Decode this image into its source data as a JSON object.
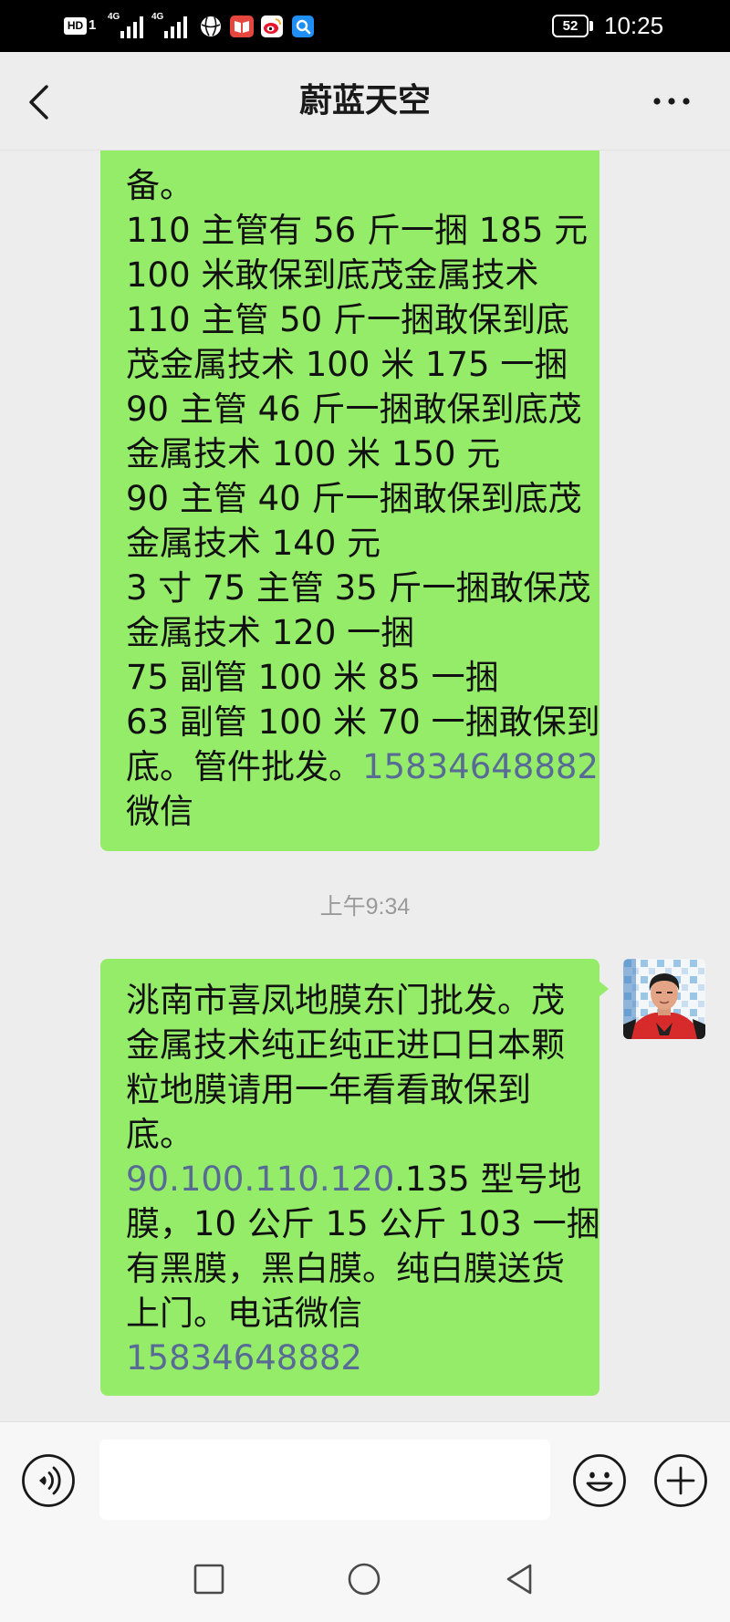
{
  "status_bar": {
    "hd_label": "HD",
    "sim_label": "1",
    "network_1": "4G",
    "network_2": "4G",
    "signal_icon": "signal-bars-icon",
    "app_icons": [
      "ball-app-icon",
      "red-book-app-icon",
      "weibo-app-icon",
      "search-app-icon"
    ],
    "battery_level": "52",
    "time": "10:25"
  },
  "header": {
    "back_icon": "chevron-left-icon",
    "title": "蔚蓝天空",
    "more_icon": "more-dots-icon"
  },
  "conversation": {
    "messages": [
      {
        "lines": [
          [
            {
              "text": "备。"
            }
          ],
          [
            {
              "text": "110 主管有 56 斤一捆 185 元"
            }
          ],
          [
            {
              "text": "100 米敢保到底茂金属技术"
            }
          ],
          [
            {
              "text": "110 主管 50 斤一捆敢保到底"
            }
          ],
          [
            {
              "text": "茂金属技术 100 米 175 一捆"
            }
          ],
          [
            {
              "text": "90 主管 46 斤一捆敢保到底茂"
            }
          ],
          [
            {
              "text": "金属技术 100 米 150 元"
            }
          ],
          [
            {
              "text": "90 主管 40 斤一捆敢保到底茂"
            }
          ],
          [
            {
              "text": "金属技术 140 元"
            }
          ],
          [
            {
              "text": "3 寸 75 主管 35 斤一捆敢保茂"
            }
          ],
          [
            {
              "text": "金属技术 120 一捆"
            }
          ],
          [
            {
              "text": "75 副管 100 米 85 一捆"
            }
          ],
          [
            {
              "text": "63 副管 100 米 70 一捆敢保到"
            }
          ],
          [
            {
              "text": "底。管件批发。"
            },
            {
              "text": "15834648882",
              "link": true
            }
          ],
          [
            {
              "text": "微信"
            }
          ]
        ]
      },
      {
        "timestamp": "上午9:34"
      },
      {
        "avatar": "user-avatar",
        "lines": [
          [
            {
              "text": "洮南市喜凤地膜东门批发。茂"
            }
          ],
          [
            {
              "text": "金属技术纯正纯正进口日本颗"
            }
          ],
          [
            {
              "text": "粒地膜请用一年看看敢保到"
            }
          ],
          [
            {
              "text": "底。"
            }
          ],
          [
            {
              "text": "90.100.110.120",
              "link": true
            },
            {
              "text": ".135 型号地"
            }
          ],
          [
            {
              "text": "膜，10 公斤 15 公斤 103 一捆"
            }
          ],
          [
            {
              "text": "有黑膜，黑白膜。纯白膜送货"
            }
          ],
          [
            {
              "text": "上门。电话微信"
            }
          ],
          [
            {
              "text": "15834648882",
              "link": true
            }
          ]
        ]
      }
    ]
  },
  "input_bar": {
    "voice_icon": "voice-icon",
    "message_value": "",
    "emoji_icon": "emoji-icon",
    "plus_icon": "plus-icon"
  },
  "nav_bar": {
    "icons": [
      "square-recent-apps-icon",
      "circle-home-icon",
      "triangle-back-icon"
    ]
  },
  "colors": {
    "status_bar_background": "#000000",
    "chat_background": "#ededed",
    "sent_bubble": "#95ec69",
    "link_text": "#576b95",
    "timestamp_text": "#9a9a9a",
    "input_bar_background": "#f7f7f7"
  }
}
